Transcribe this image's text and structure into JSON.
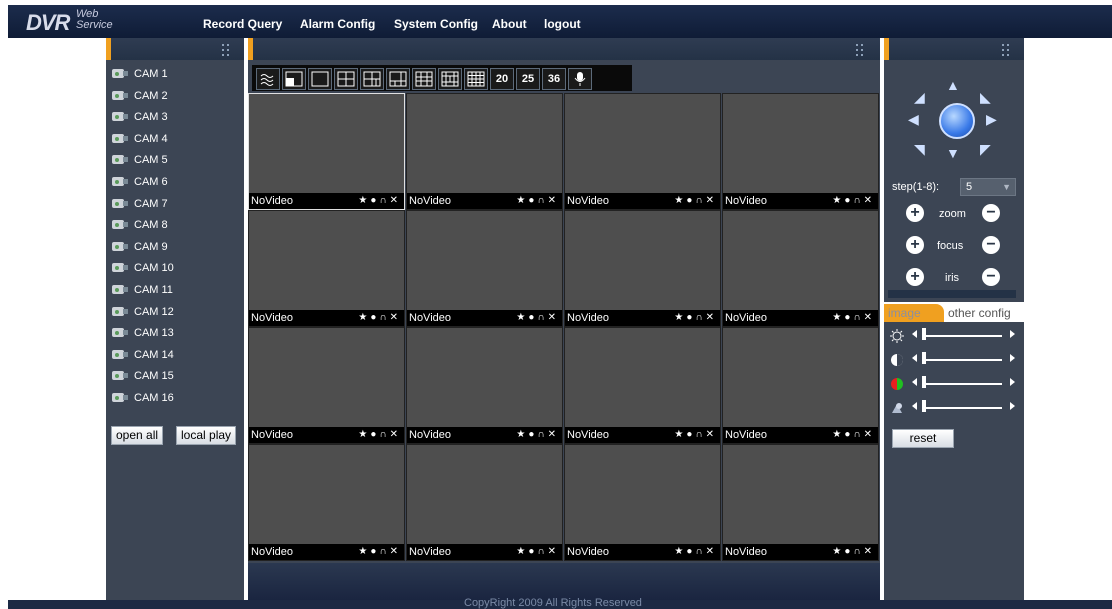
{
  "logo": {
    "brand": "DVR",
    "web": "Web",
    "service": "Service"
  },
  "menu": [
    "Record Query",
    "Alarm Config",
    "System Config",
    "About",
    "logout"
  ],
  "cameras": [
    "CAM 1",
    "CAM 2",
    "CAM 3",
    "CAM 4",
    "CAM 5",
    "CAM 6",
    "CAM 7",
    "CAM 8",
    "CAM 9",
    "CAM 10",
    "CAM 11",
    "CAM 12",
    "CAM 13",
    "CAM 14",
    "CAM 15",
    "CAM 16"
  ],
  "left_buttons": {
    "open_all": "open all",
    "local_play": "local play"
  },
  "toolbar": {
    "n20": "20",
    "n25": "25",
    "n36": "36"
  },
  "video": {
    "no_video": "NoVideo",
    "status_icons": "★●∩✕"
  },
  "ptz": {
    "step_label": "step(1-8):",
    "step_value": "5",
    "zoom": "zoom",
    "focus": "focus",
    "iris": "iris"
  },
  "tabs": {
    "image": "image",
    "other": "other config"
  },
  "image_sliders": [
    {
      "name": "brightness",
      "level": 0.0
    },
    {
      "name": "contrast",
      "level": 0.0
    },
    {
      "name": "saturation",
      "level": 0.0
    },
    {
      "name": "hue",
      "level": 0.0
    }
  ],
  "reset": "reset",
  "footer": "CopyRight 2009 All Rights Reserved",
  "colors": {
    "accent": "#f0a020",
    "panel": "#3c4554",
    "header": "#15233f",
    "cell": "#4e4e4e"
  }
}
